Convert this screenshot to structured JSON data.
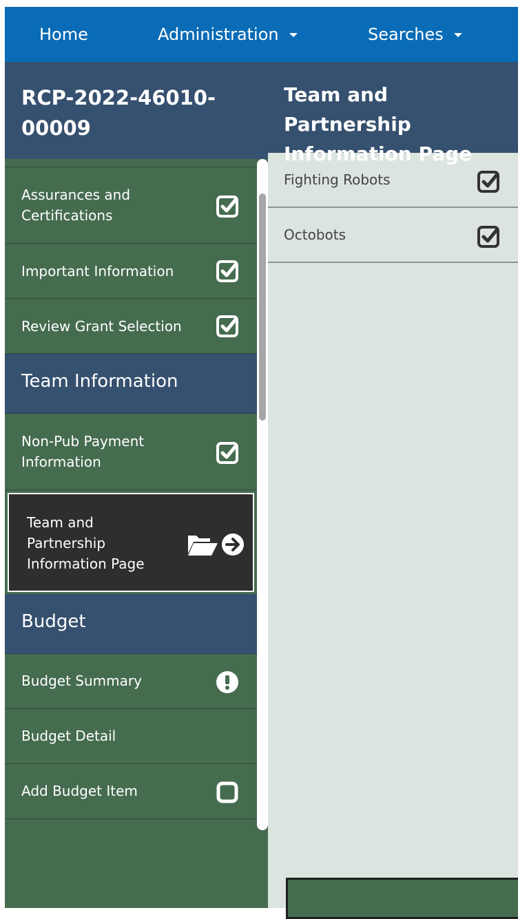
{
  "navbar": {
    "items": [
      {
        "label": "Home",
        "has_caret": false
      },
      {
        "label": "Administration",
        "has_caret": true
      },
      {
        "label": "Searches",
        "has_caret": true
      }
    ]
  },
  "sidebar": {
    "grant_id": "RCP-2022-46010-00009",
    "items": [
      {
        "label": "Assurances and Certifications",
        "status_icon": "checked-square-icon"
      },
      {
        "label": "Important Information",
        "status_icon": "checked-square-icon"
      },
      {
        "label": "Review Grant Selection",
        "status_icon": "checked-square-icon"
      }
    ],
    "sections": [
      {
        "label": "Team Information"
      },
      {
        "label": "Budget"
      }
    ],
    "team_items": [
      {
        "label": "Non-Pub Payment Information",
        "status_icon": "checked-square-icon"
      }
    ],
    "active_item": {
      "label": "Team and Partnership Information Page",
      "icons": [
        "open-folder-icon",
        "arrow-circle-right-icon"
      ]
    },
    "budget_items": [
      {
        "label": "Budget Summary",
        "status_icon": "exclamation-circle-icon"
      },
      {
        "label": "Budget Detail",
        "status_icon": ""
      },
      {
        "label": "Add Budget Item",
        "status_icon": "empty-square-icon"
      }
    ]
  },
  "main": {
    "title": "Team and Partnership Information Page",
    "teams": [
      {
        "name": "Fighting Robots",
        "status_icon": "checked-square-icon"
      },
      {
        "name": "Octobots",
        "status_icon": "checked-square-icon"
      }
    ]
  },
  "colors": {
    "navbar": "#0a6bb6",
    "header": "#36506f",
    "sidebar_green": "#466c50",
    "active_item": "#2e2e2e",
    "main_bg": "#dbe4de"
  }
}
